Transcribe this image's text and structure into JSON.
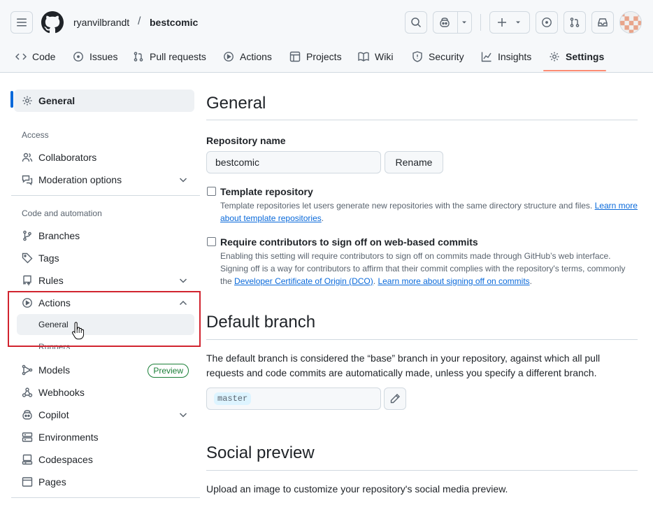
{
  "header": {
    "owner": "ryanvilbrandt",
    "separator": "/",
    "repo": "bestcomic"
  },
  "tabs": [
    {
      "label": "Code",
      "icon": "code-icon"
    },
    {
      "label": "Issues",
      "icon": "issue-icon"
    },
    {
      "label": "Pull requests",
      "icon": "pull-request-icon"
    },
    {
      "label": "Actions",
      "icon": "play-icon"
    },
    {
      "label": "Projects",
      "icon": "table-icon"
    },
    {
      "label": "Wiki",
      "icon": "book-icon"
    },
    {
      "label": "Security",
      "icon": "shield-icon"
    },
    {
      "label": "Insights",
      "icon": "graph-icon"
    },
    {
      "label": "Settings",
      "icon": "gear-icon"
    }
  ],
  "sidebar": {
    "general": "General",
    "access_heading": "Access",
    "collaborators": "Collaborators",
    "moderation": "Moderation options",
    "code_heading": "Code and automation",
    "branches": "Branches",
    "tags": "Tags",
    "rules": "Rules",
    "actions": "Actions",
    "actions_general": "General",
    "actions_runners": "Runners",
    "models": "Models",
    "models_badge": "Preview",
    "webhooks": "Webhooks",
    "copilot": "Copilot",
    "environments": "Environments",
    "codespaces": "Codespaces",
    "pages": "Pages"
  },
  "main": {
    "general_title": "General",
    "repo_name_label": "Repository name",
    "repo_name_value": "bestcomic",
    "rename_button": "Rename",
    "template_label": "Template repository",
    "template_note": "Template repositories let users generate new repositories with the same directory structure and files.",
    "template_link": "Learn more about template repositories",
    "signoff_label": "Require contributors to sign off on web-based commits",
    "signoff_note_1": "Enabling this setting will require contributors to sign off on commits made through GitHub’s web interface. Signing off is a way for contributors to affirm that their commit complies with the repository's terms, commonly the",
    "signoff_link_1": "Developer Certificate of Origin (DCO)",
    "signoff_link_2": "Learn more about signing off on commits",
    "default_branch_title": "Default branch",
    "default_branch_desc": "The default branch is considered the “base” branch in your repository, against which all pull requests and code commits are automatically made, unless you specify a different branch.",
    "default_branch_value": "master",
    "social_title": "Social preview",
    "social_desc": "Upload an image to customize your repository's social media preview."
  },
  "colors": {
    "accent": "#0969da",
    "tab_underline": "#fd8c73",
    "highlight_box": "#d1242f",
    "preview_badge": "#1a7f37"
  }
}
